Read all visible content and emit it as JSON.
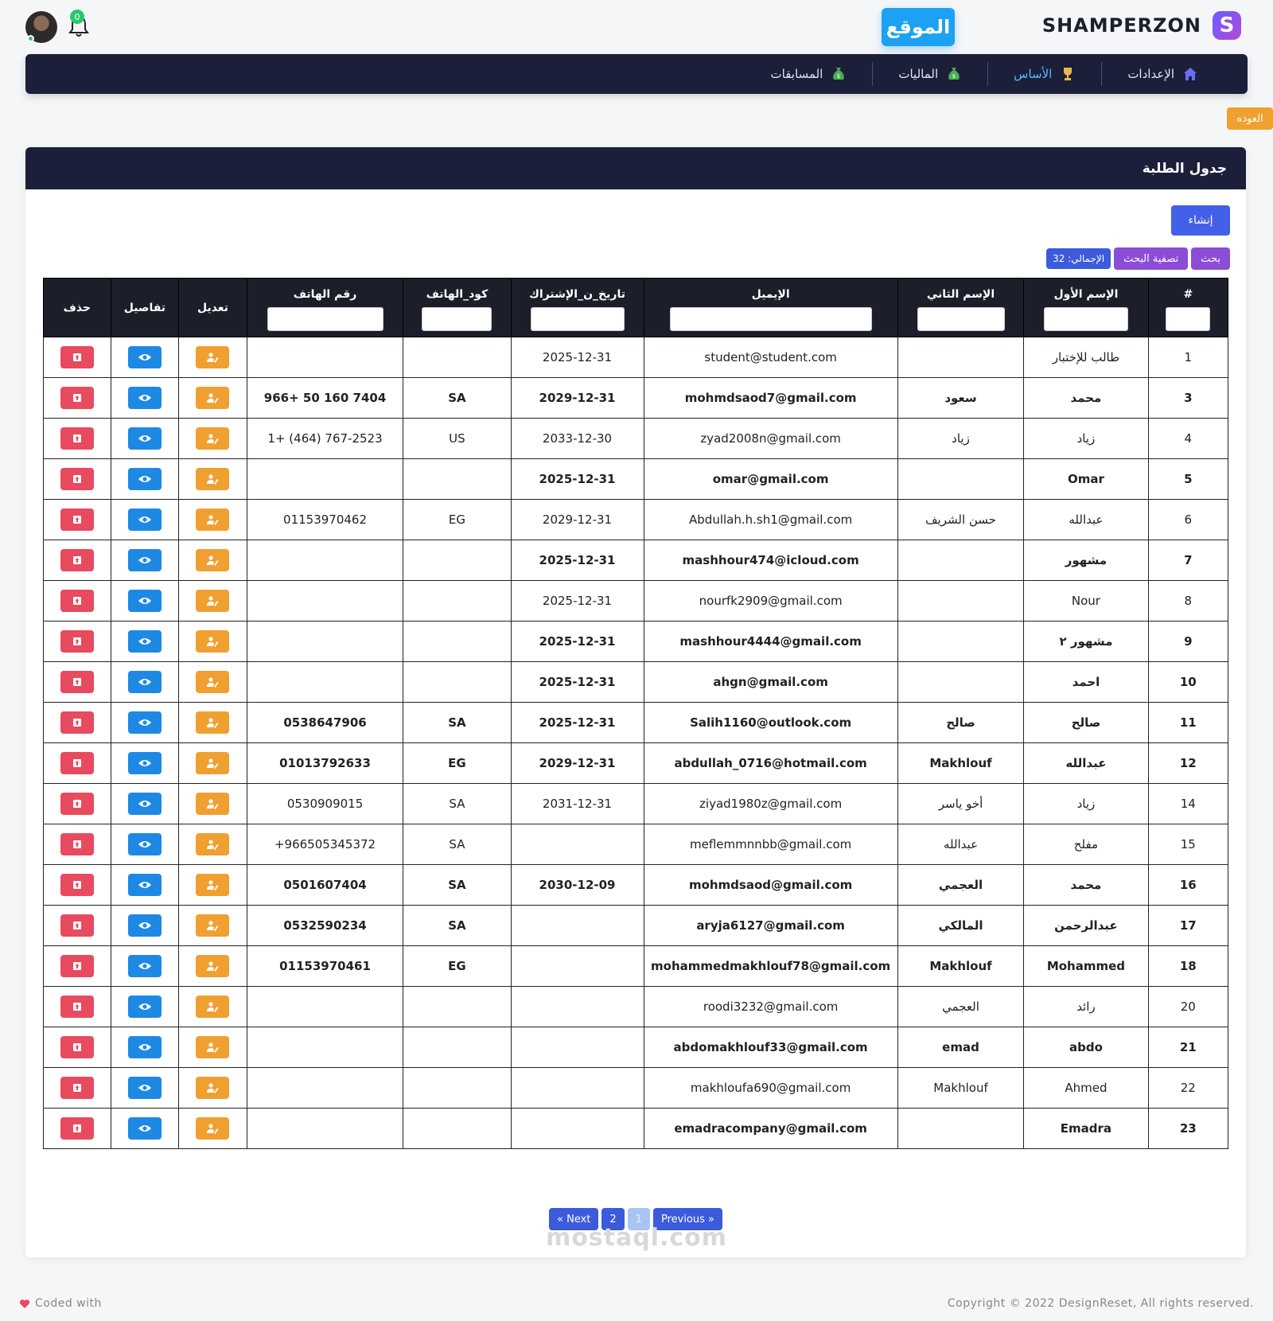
{
  "header": {
    "brand_name": "SHAMPERZON",
    "brand_logo": "S",
    "site_button": "الموقع",
    "notifications_count": "0"
  },
  "nav": {
    "items": [
      {
        "label": "الإعدادات",
        "icon": "home-icon",
        "active": false
      },
      {
        "label": "الأساس",
        "icon": "trophy-icon",
        "active": true
      },
      {
        "label": "الماليات",
        "icon": "money-bag-icon",
        "active": false
      },
      {
        "label": "المسابقات",
        "icon": "money-bag-icon",
        "active": false
      }
    ]
  },
  "back_button": "العوده",
  "card": {
    "title": "جدول الطلبة",
    "create_button": "إنشاء",
    "search_button": "بحث",
    "filter_button": "تصفية البحث",
    "total_label": "الإجمالي: 32"
  },
  "table": {
    "columns": [
      "#",
      "الإسم الأول",
      "الإسم الثاني",
      "الإيميل",
      "تاريخ_ن_الإشتراك",
      "كود_الهاتف",
      "رقم الهاتف",
      "تعديل",
      "تفاصيل",
      "حذف"
    ],
    "rows": [
      [
        "1",
        "طالب للإختبار",
        "",
        "student@student.com",
        "2025-12-31",
        "",
        ""
      ],
      [
        "3",
        "محمد",
        "سعود",
        "mohmdsaod7@gmail.com",
        "2029-12-31",
        "SA",
        "966+ 50 160 7404"
      ],
      [
        "4",
        "زياد",
        "زياد",
        "zyad2008n@gmail.com",
        "2033-12-30",
        "US",
        "1+ (464) 767-2523"
      ],
      [
        "5",
        "Omar",
        "",
        "omar@gmail.com",
        "2025-12-31",
        "",
        ""
      ],
      [
        "6",
        "عبدالله",
        "حسن الشريف",
        "Abdullah.h.sh1@gmail.com",
        "2029-12-31",
        "EG",
        "01153970462"
      ],
      [
        "7",
        "مشهور",
        "",
        "mashhour474@icloud.com",
        "2025-12-31",
        "",
        ""
      ],
      [
        "8",
        "Nour",
        "",
        "nourfk2909@gmail.com",
        "2025-12-31",
        "",
        ""
      ],
      [
        "9",
        "مشهور ٢",
        "",
        "mashhour4444@gmail.com",
        "2025-12-31",
        "",
        ""
      ],
      [
        "10",
        "احمد",
        "",
        "ahgn@gmail.com",
        "2025-12-31",
        "",
        ""
      ],
      [
        "11",
        "صالح",
        "صالح",
        "Salih1160@outlook.com",
        "2025-12-31",
        "SA",
        "0538647906"
      ],
      [
        "12",
        "عبدالله",
        "Makhlouf",
        "abdullah_0716@hotmail.com",
        "2029-12-31",
        "EG",
        "01013792633"
      ],
      [
        "14",
        "زياد",
        "أخو ياسر",
        "ziyad1980z@gmail.com",
        "2031-12-31",
        "SA",
        "0530909015"
      ],
      [
        "15",
        "مفلح",
        "عبدالله",
        "meflemmnnbb@gmail.com",
        "",
        "SA",
        "+966505345372"
      ],
      [
        "16",
        "محمد",
        "العجمي",
        "mohmdsaod@gmail.com",
        "2030-12-09",
        "SA",
        "0501607404"
      ],
      [
        "17",
        "عبدالرحمن",
        "المالكي",
        "aryja6127@gmail.com",
        "",
        "SA",
        "0532590234"
      ],
      [
        "18",
        "Mohammed",
        "Makhlouf",
        "mohammedmakhlouf78@gmail.com",
        "",
        "EG",
        "01153970461"
      ],
      [
        "20",
        "رائد",
        "العجمي",
        "roodi3232@gmail.com",
        "",
        "",
        ""
      ],
      [
        "21",
        "abdo",
        "emad",
        "abdomakhlouf33@gmail.com",
        "",
        "",
        ""
      ],
      [
        "22",
        "Ahmed",
        "Makhlouf",
        "makhloufa690@gmail.com",
        "",
        "",
        ""
      ],
      [
        "23",
        "Emadra",
        "",
        "emadracompany@gmail.com",
        "",
        "",
        ""
      ]
    ]
  },
  "pagination": {
    "next": "« Next",
    "pages": [
      "2",
      "1"
    ],
    "current": "1",
    "previous": "Previous »"
  },
  "footer": {
    "left": "Coded with",
    "right": "Copyright © 2022 DesignReset, All rights reserved."
  },
  "watermark": "mostaql.com",
  "colors": {
    "navbar": "#1c1f3a",
    "accent_blue": "#4460e8",
    "purple": "#8b4dd6",
    "delete": "#e84a5f",
    "details": "#1e88e5",
    "edit": "#f0a030",
    "site_button": "#1da1f2"
  }
}
